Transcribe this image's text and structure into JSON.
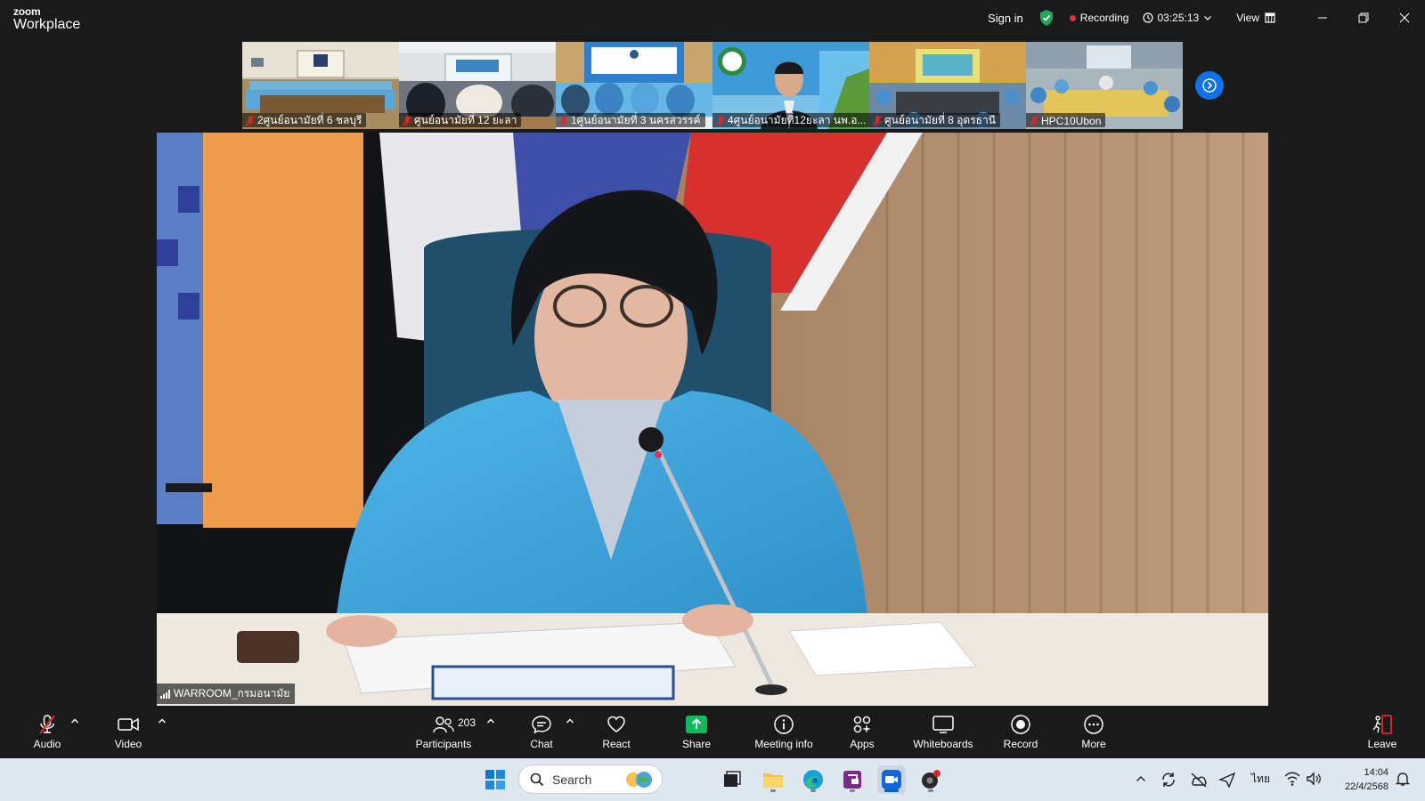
{
  "app": {
    "brand_top": "zoom",
    "brand_bottom": "Workplace"
  },
  "titlebar": {
    "sign_in": "Sign in",
    "recording": "Recording",
    "timer": "03:25:13",
    "view": "View",
    "colors": {
      "shield": "#23a55a",
      "record_dot": "#e5303d"
    }
  },
  "thumbnails": [
    {
      "name": "2ศูนย์อนามัยที่ 6 ชลบุรี",
      "muted": true
    },
    {
      "name": "ศูนย์อนามัยที่ 12 ยะลา",
      "muted": true
    },
    {
      "name": "1ศูนย์อนามัยที่ 3 นครสวรรค์",
      "muted": true
    },
    {
      "name": "4ศูนย์อนามัยที่12ยะลา นพ.อ...",
      "muted": true
    },
    {
      "name": "ศูนย์อนามัยที่ 8 อุดรธานี",
      "muted": true
    },
    {
      "name": "HPC10Ubon",
      "muted": true
    }
  ],
  "main_video": {
    "speaker_name": "WARROOM_กรมอนามัย"
  },
  "toolbar": {
    "audio": "Audio",
    "video": "Video",
    "participants": "Participants",
    "participants_count": "203",
    "chat": "Chat",
    "react": "React",
    "share": "Share",
    "meeting_info": "Meeting info",
    "apps": "Apps",
    "whiteboards": "Whiteboards",
    "record": "Record",
    "more": "More",
    "leave": "Leave",
    "colors": {
      "share": "#0dbb5d",
      "leave": "#e02828"
    }
  },
  "taskbar": {
    "search_placeholder": "Search",
    "language": "ไทย",
    "time": "14:04",
    "date": "22/4/2568"
  }
}
